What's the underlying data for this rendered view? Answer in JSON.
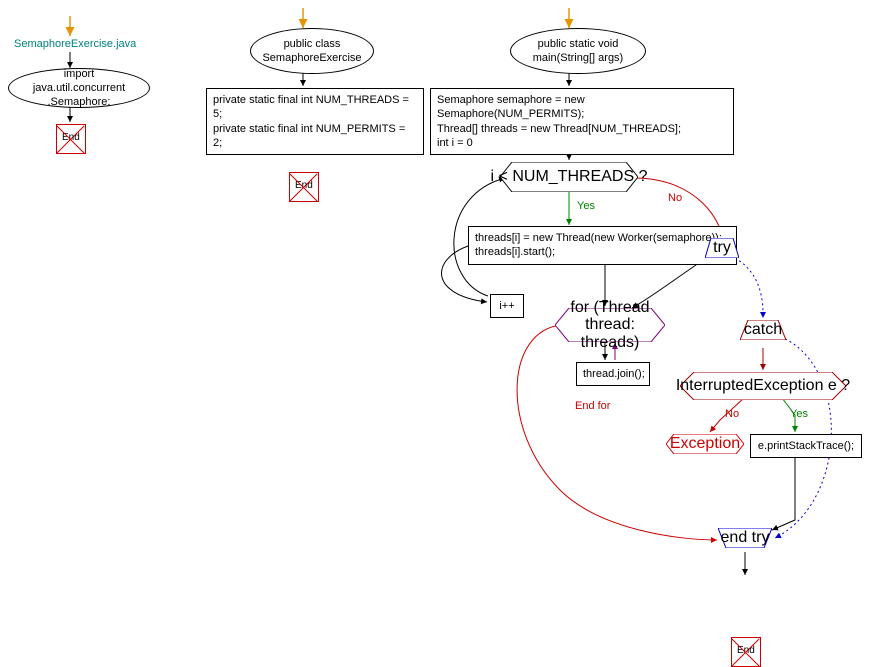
{
  "title": "SemaphoreExercise.java",
  "flow1": {
    "start": "SemaphoreExercise.java",
    "import": "import java.util.concurrent\n.Semaphore;",
    "end": "End"
  },
  "flow2": {
    "class": "public class\nSemaphoreExercise",
    "fields": "private static final int NUM_THREADS = 5;\nprivate static final int NUM_PERMITS = 2;",
    "end": "End"
  },
  "flow3": {
    "main": "public static void\nmain(String[] args)",
    "init": "Semaphore semaphore = new Semaphore(NUM_PERMITS);\nThread[] threads = new Thread[NUM_THREADS];\nint i = 0",
    "cond": "i < NUM_THREADS ?",
    "yes": "Yes",
    "no": "No",
    "body": "threads[i] = new Thread(new Worker(semaphore));\nthreads[i].start();",
    "inc": "i++",
    "try": "try",
    "for": "for (Thread\nthread: threads)",
    "join": "thread.join();",
    "endfor": "End for",
    "catch": "catch",
    "exccond": "InterruptedException e ?",
    "exc_yes": "Yes",
    "exc_no": "No",
    "exception": "Exception",
    "stacktrace": "e.printStackTrace();",
    "endtry": "end try",
    "end": "End"
  }
}
